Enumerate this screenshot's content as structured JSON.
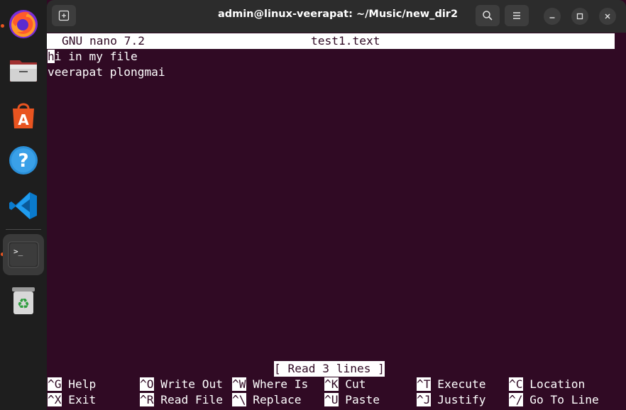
{
  "dock": {
    "items": [
      {
        "name": "firefox",
        "icon": "firefox-icon",
        "running": true
      },
      {
        "name": "files",
        "icon": "files-icon",
        "running": false
      },
      {
        "name": "app-center",
        "icon": "app-center-icon",
        "running": false
      },
      {
        "name": "help",
        "icon": "help-icon",
        "running": false
      },
      {
        "name": "vscode",
        "icon": "vscode-icon",
        "running": false
      },
      {
        "name": "terminal",
        "icon": "terminal-icon",
        "running": true,
        "active": true
      },
      {
        "name": "trash",
        "icon": "trash-icon",
        "running": false
      }
    ]
  },
  "window": {
    "title": "admin@linux-veerapat: ~/Music/new_dir2"
  },
  "nano": {
    "app_version": "GNU nano 7.2",
    "filename": "test1.text",
    "lines": [
      "hi in my file",
      "veerapat plongmai"
    ],
    "cursor_char": "h",
    "first_line_rest": "i in my file",
    "status": "[ Read 3 lines ]",
    "shortcuts_row1": [
      {
        "key": "^G",
        "label": "Help"
      },
      {
        "key": "^O",
        "label": "Write Out"
      },
      {
        "key": "^W",
        "label": "Where Is"
      },
      {
        "key": "^K",
        "label": "Cut"
      },
      {
        "key": "^T",
        "label": "Execute"
      },
      {
        "key": "^C",
        "label": "Location"
      }
    ],
    "shortcuts_row2": [
      {
        "key": "^X",
        "label": "Exit"
      },
      {
        "key": "^R",
        "label": "Read File"
      },
      {
        "key": "^\\",
        "label": "Replace"
      },
      {
        "key": "^U",
        "label": "Paste"
      },
      {
        "key": "^J",
        "label": "Justify"
      },
      {
        "key": "^/",
        "label": "Go To Line"
      }
    ]
  },
  "colors": {
    "terminal_bg": "#300a24",
    "accent": "#e95420",
    "titlebar": "#2c2c2c"
  }
}
